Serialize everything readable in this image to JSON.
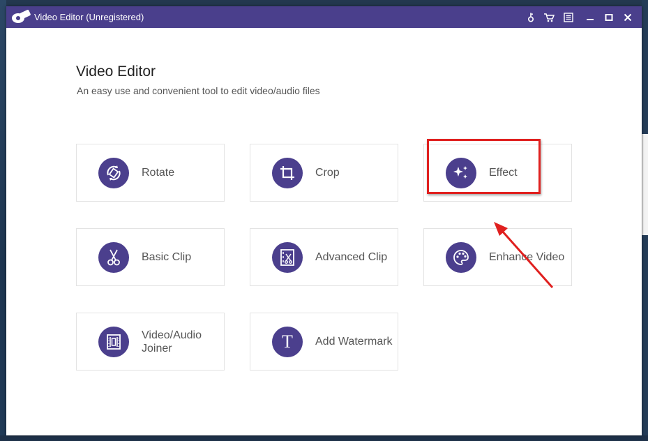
{
  "window": {
    "title": "Video Editor (Unregistered)"
  },
  "titlebar_icons": [
    "key-icon",
    "cart-icon",
    "menu-icon",
    "minimize-icon",
    "maximize-icon",
    "close-icon"
  ],
  "header": {
    "title": "Video Editor",
    "subtitle": "An easy use and convenient tool to edit video/audio files"
  },
  "tools": [
    {
      "label": "Rotate",
      "icon": "rotate-icon"
    },
    {
      "label": "Crop",
      "icon": "crop-icon"
    },
    {
      "label": "Effect",
      "icon": "sparkle-icon"
    },
    {
      "label": "Basic Clip",
      "icon": "scissors-icon"
    },
    {
      "label": "Advanced Clip",
      "icon": "advanced-clip-icon"
    },
    {
      "label": "Enhance Video",
      "icon": "palette-icon"
    },
    {
      "label": "Video/Audio Joiner",
      "icon": "joiner-icon"
    },
    {
      "label": "Add Watermark",
      "icon": "text-t-icon"
    }
  ],
  "colors": {
    "titlebar": "#4a3f8c",
    "icon_circle": "#4b3f8d",
    "highlight": "#e0201f"
  }
}
